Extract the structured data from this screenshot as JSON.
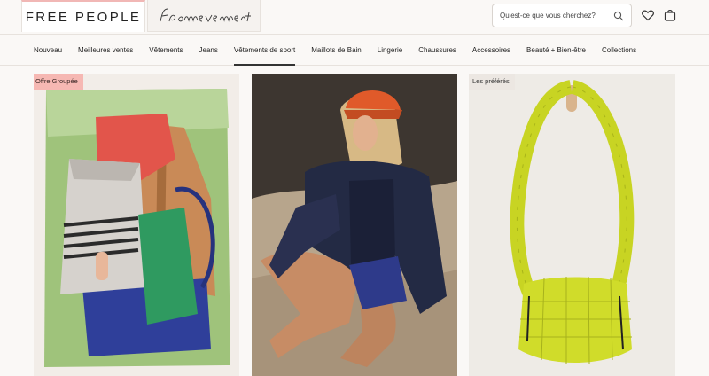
{
  "brand": {
    "logo_text": "FREE PEOPLE",
    "sub_brand": "fpmovement"
  },
  "search": {
    "placeholder": "Qu'est-ce que vous cherchez?",
    "icon": "search-icon"
  },
  "header_icons": {
    "wishlist": "heart-icon",
    "cart": "bag-icon"
  },
  "nav": {
    "items": [
      {
        "label": "Nouveau"
      },
      {
        "label": "Meilleures ventes"
      },
      {
        "label": "Vêtements"
      },
      {
        "label": "Jeans"
      },
      {
        "label": "Vêtements de sport",
        "active": true
      },
      {
        "label": "Maillots de Bain"
      },
      {
        "label": "Lingerie"
      },
      {
        "label": "Chaussures"
      },
      {
        "label": "Accessoires"
      },
      {
        "label": "Beauté + Bien-être"
      },
      {
        "label": "Collections"
      }
    ]
  },
  "tiles": [
    {
      "badge": "Offre Groupée",
      "badge_color": "#f6b8b3"
    },
    {
      "badge": ""
    },
    {
      "badge": "Les préférés",
      "badge_color": "#ece7e2"
    }
  ]
}
